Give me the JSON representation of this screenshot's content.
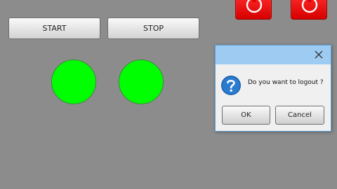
{
  "controls": {
    "start_label": "START",
    "stop_label": "STOP"
  },
  "indicators": {
    "lamp_1_color": "#00ff00",
    "lamp_2_color": "#00ff00"
  },
  "top_buttons": {
    "color": "#ee0000",
    "icon": "power-icon"
  },
  "dialog": {
    "message": "Do you want to logout ?",
    "ok_label": "OK",
    "cancel_label": "Cancel",
    "icon": "question-icon",
    "close_icon": "close-icon"
  }
}
